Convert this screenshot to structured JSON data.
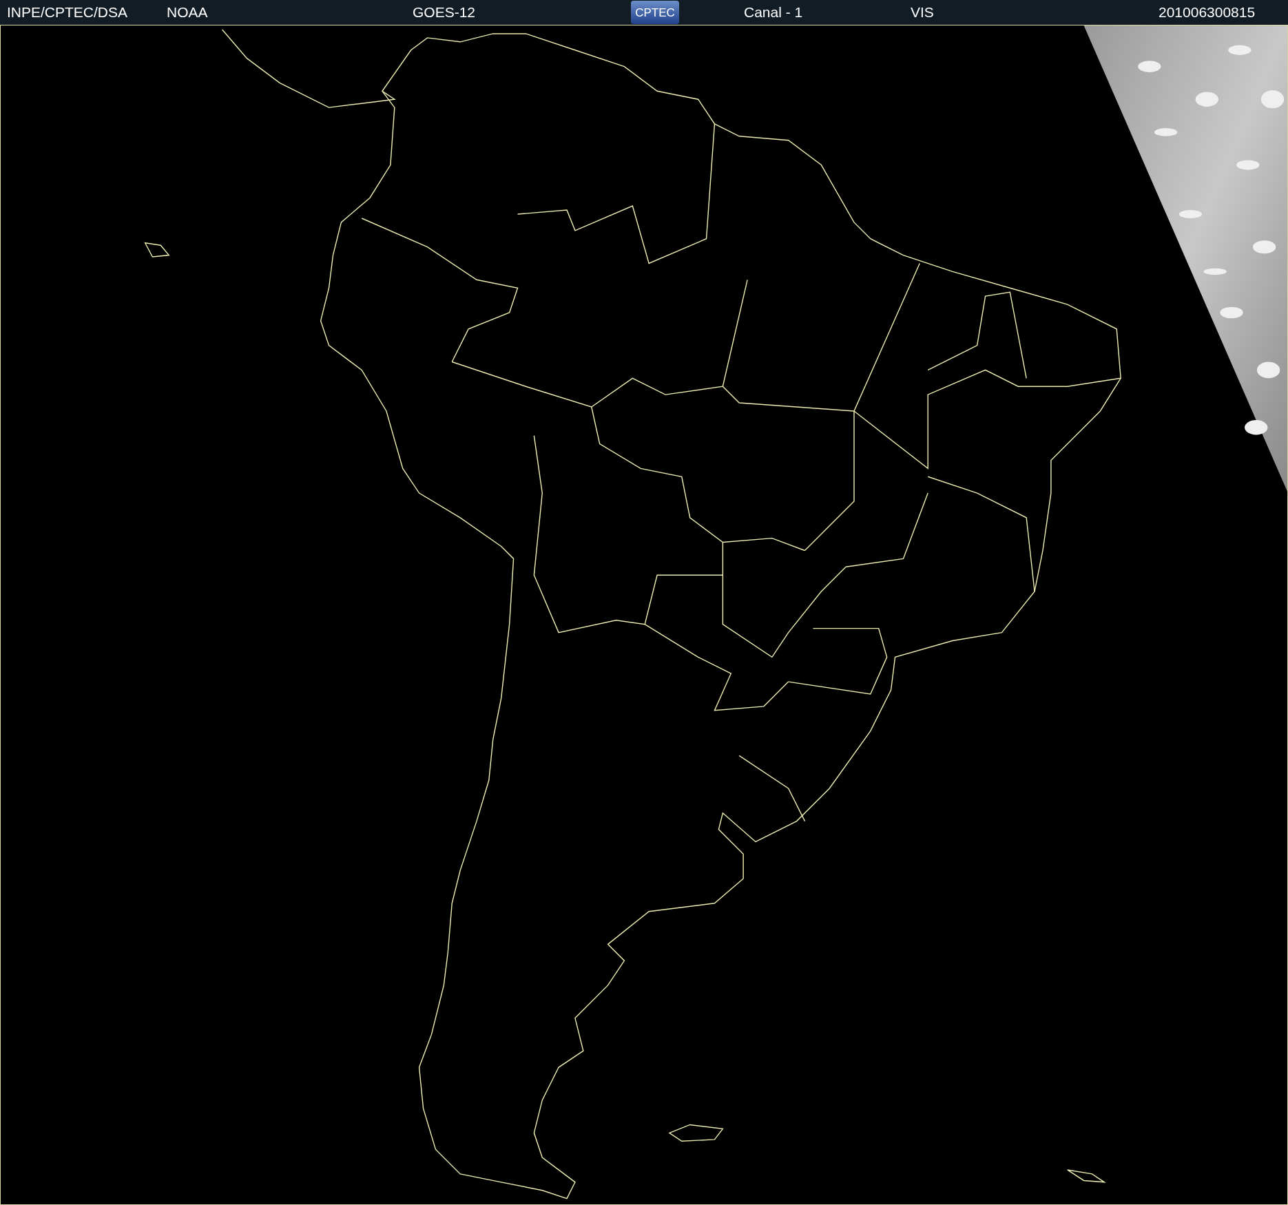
{
  "header": {
    "source": "INPE/CPTEC/DSA",
    "agency": "NOAA",
    "satellite": "GOES-12",
    "logo": "CPTEC",
    "channel": "Canal - 1",
    "band": "VIS",
    "timestamp": "201006300815"
  }
}
